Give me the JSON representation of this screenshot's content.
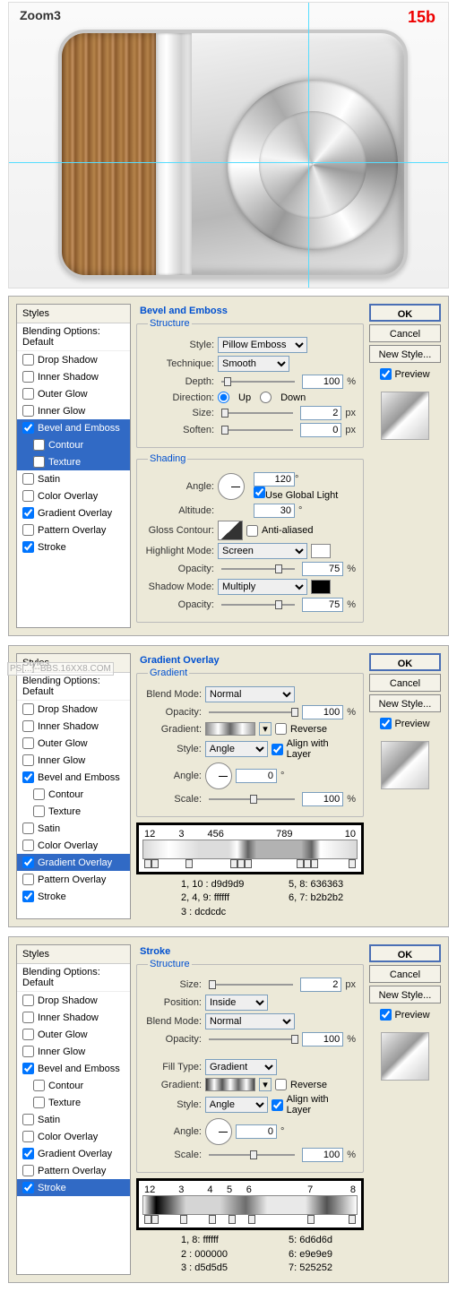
{
  "header": {
    "title": "Zoom3",
    "step": "15b"
  },
  "watermark": "PS[...]--BBS.16XX8.COM",
  "styles_header": "Styles",
  "blending_options": "Blending Options: Default",
  "effects": {
    "drop_shadow": "Drop Shadow",
    "inner_shadow": "Inner Shadow",
    "outer_glow": "Outer Glow",
    "inner_glow": "Inner Glow",
    "bevel": "Bevel and Emboss",
    "contour": "Contour",
    "texture": "Texture",
    "satin": "Satin",
    "color_overlay": "Color Overlay",
    "gradient_overlay": "Gradient Overlay",
    "pattern_overlay": "Pattern Overlay",
    "stroke": "Stroke"
  },
  "buttons": {
    "ok": "OK",
    "cancel": "Cancel",
    "new_style": "New Style...",
    "preview": "Preview"
  },
  "bevel": {
    "title": "Bevel and Emboss",
    "structure": "Structure",
    "style_lbl": "Style:",
    "style_val": "Pillow Emboss",
    "tech_lbl": "Technique:",
    "tech_val": "Smooth",
    "depth_lbl": "Depth:",
    "depth_val": "100",
    "pct": "%",
    "dir_lbl": "Direction:",
    "up": "Up",
    "down": "Down",
    "size_lbl": "Size:",
    "size_val": "2",
    "px": "px",
    "soften_lbl": "Soften:",
    "soften_val": "0",
    "shading": "Shading",
    "angle_lbl": "Angle:",
    "angle_val": "120",
    "deg": "°",
    "global": "Use Global Light",
    "alt_lbl": "Altitude:",
    "alt_val": "30",
    "gloss_lbl": "Gloss Contour:",
    "aa": "Anti-aliased",
    "hi_lbl": "Highlight Mode:",
    "hi_val": "Screen",
    "hi_op": "75",
    "sh_lbl": "Shadow Mode:",
    "sh_val": "Multiply",
    "sh_op": "75",
    "op_lbl": "Opacity:"
  },
  "grad": {
    "title": "Gradient Overlay",
    "sub": "Gradient",
    "blend_lbl": "Blend Mode:",
    "blend_val": "Normal",
    "op_lbl": "Opacity:",
    "op_val": "100",
    "pct": "%",
    "grad_lbl": "Gradient:",
    "reverse": "Reverse",
    "style_lbl": "Style:",
    "style_val": "Angle",
    "align": "Align with Layer",
    "angle_lbl": "Angle:",
    "angle_val": "0",
    "deg": "°",
    "scale_lbl": "Scale:",
    "scale_val": "100",
    "stops_top": [
      "1",
      "2",
      "3",
      "",
      "4",
      "5",
      "6",
      "",
      "7",
      "8",
      "9",
      "",
      "10"
    ],
    "legend": {
      "r1a": "1, 10  : d9d9d9",
      "r1b": "5, 8: 636363",
      "r2a": "2, 4, 9: ffffff",
      "r2b": "6, 7: b2b2b2",
      "r3a": "3       : dcdcdc"
    }
  },
  "stroke": {
    "title": "Stroke",
    "structure": "Structure",
    "size_lbl": "Size:",
    "size_val": "2",
    "px": "px",
    "pos_lbl": "Position:",
    "pos_val": "Inside",
    "blend_lbl": "Blend Mode:",
    "blend_val": "Normal",
    "op_lbl": "Opacity:",
    "op_val": "100",
    "pct": "%",
    "fill_lbl": "Fill Type:",
    "fill_val": "Gradient",
    "grad_lbl": "Gradient:",
    "reverse": "Reverse",
    "style_lbl": "Style:",
    "style_val": "Angle",
    "align": "Align with Layer",
    "angle_lbl": "Angle:",
    "angle_val": "0",
    "deg": "°",
    "scale_lbl": "Scale:",
    "scale_val": "100",
    "stops_top": [
      "1",
      "2",
      "3",
      "4",
      "5",
      "6",
      "",
      "7",
      "",
      "8"
    ],
    "legend": {
      "r1a": "1, 8: ffffff",
      "r1b": "5: 6d6d6d",
      "r2a": "2   : 000000",
      "r2b": "6: e9e9e9",
      "r3a": "3   : d5d5d5",
      "r3b": "7: 525252"
    }
  }
}
